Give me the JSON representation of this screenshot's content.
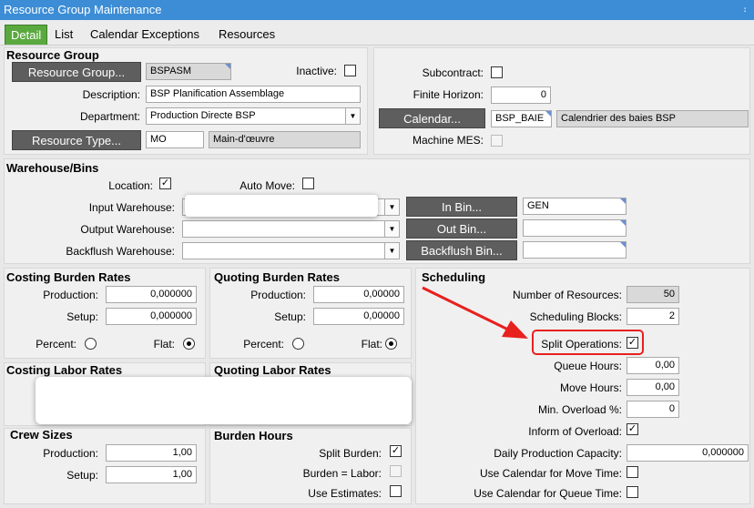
{
  "window": {
    "title": "Resource Group Maintenance",
    "pin": "։"
  },
  "tabs": [
    "Detail",
    "List",
    "Calendar Exceptions",
    "Resources"
  ],
  "resource_group": {
    "header": "Resource Group",
    "btn": "Resource Group...",
    "value": "BSPASM",
    "inactive_label": "Inactive:",
    "description_label": "Description:",
    "description": "BSP Planification Assemblage",
    "department_label": "Department:",
    "department": "Production Directe BSP",
    "type_btn": "Resource Type...",
    "type_code": "MO",
    "type_desc": "Main-d'œuvre",
    "subcontract_label": "Subcontract:",
    "finite_label": "Finite Horizon:",
    "finite_value": "0",
    "calendar_btn": "Calendar...",
    "calendar_code": "BSP_BAIE",
    "calendar_desc": "Calendrier des baies BSP",
    "machine_label": "Machine MES:"
  },
  "warehouse": {
    "header": "Warehouse/Bins",
    "location_label": "Location:",
    "location_checked": "✓",
    "auto_move_label": "Auto Move:",
    "input_label": "Input Warehouse:",
    "output_label": "Output Warehouse:",
    "backflush_label": "Backflush Warehouse:",
    "in_bin_btn": "In Bin...",
    "out_bin_btn": "Out Bin...",
    "backflush_bin_btn": "Backflush Bin...",
    "in_bin_value": "GEN"
  },
  "costing_burden": {
    "header": "Costing Burden Rates",
    "production_label": "Production:",
    "production": "0,000000",
    "setup_label": "Setup:",
    "setup": "0,000000",
    "percent_label": "Percent:",
    "flat_label": "Flat:"
  },
  "quoting_burden": {
    "header": "Quoting Burden Rates",
    "production_label": "Production:",
    "production": "0,00000",
    "setup_label": "Setup:",
    "setup": "0,00000",
    "percent_label": "Percent:",
    "flat_label": "Flat:"
  },
  "costing_labor": {
    "header": "Costing Labor Rates"
  },
  "quoting_labor": {
    "header": "Quoting Labor Rates"
  },
  "crew": {
    "header": "Crew Sizes",
    "production_label": "Production:",
    "production": "1,00",
    "setup_label": "Setup:",
    "setup": "1,00"
  },
  "burden_hours": {
    "header": "Burden Hours",
    "split_label": "Split Burden:",
    "split_checked": "✓",
    "equals_labor_label": "Burden = Labor:",
    "use_estimates_label": "Use Estimates:"
  },
  "scheduling": {
    "header": "Scheduling",
    "num_resources_label": "Number of Resources:",
    "num_resources": "50",
    "blocks_label": "Scheduling Blocks:",
    "blocks": "2",
    "split_ops_label": "Split Operations:",
    "split_ops_checked": "✓",
    "queue_label": "Queue Hours:",
    "queue": "0,00",
    "move_label": "Move Hours:",
    "move": "0,00",
    "overload_label": "Min. Overload %:",
    "overload": "0",
    "inform_label": "Inform of Overload:",
    "inform_checked": "✓",
    "daily_label": "Daily Production Capacity:",
    "daily": "0,000000",
    "cal_move_label": "Use Calendar for Move Time:",
    "cal_queue_label": "Use Calendar for Queue Time:"
  },
  "colors": {
    "title": "#3c8dd6",
    "active_tab": "#5aa93f",
    "annotation": "#e8201e"
  }
}
